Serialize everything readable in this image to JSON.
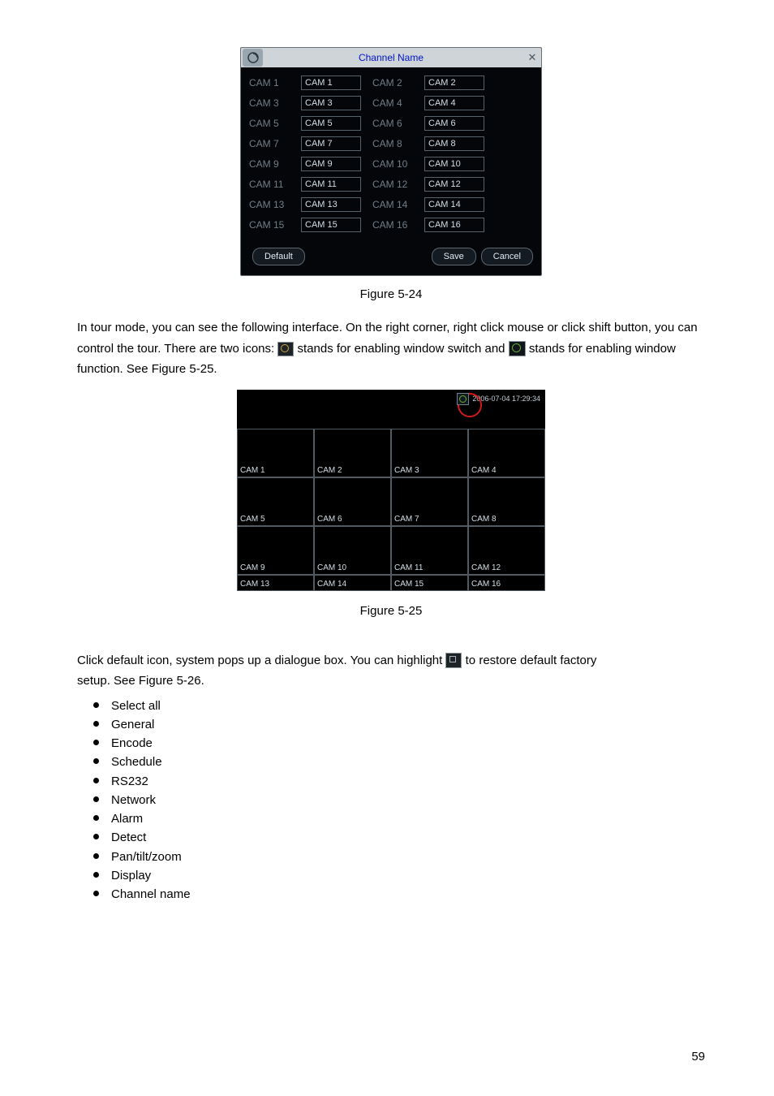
{
  "dialog": {
    "title": "Channel Name",
    "rows": [
      {
        "l1": "CAM 1",
        "v1": "CAM 1",
        "l2": "CAM 2",
        "v2": "CAM 2"
      },
      {
        "l1": "CAM 3",
        "v1": "CAM 3",
        "l2": "CAM 4",
        "v2": "CAM 4"
      },
      {
        "l1": "CAM 5",
        "v1": "CAM 5",
        "l2": "CAM 6",
        "v2": "CAM 6"
      },
      {
        "l1": "CAM 7",
        "v1": "CAM 7",
        "l2": "CAM 8",
        "v2": "CAM 8"
      },
      {
        "l1": "CAM 9",
        "v1": "CAM 9",
        "l2": "CAM 10",
        "v2": "CAM 10"
      },
      {
        "l1": "CAM 11",
        "v1": "CAM 11",
        "l2": "CAM 12",
        "v2": "CAM 12"
      },
      {
        "l1": "CAM 13",
        "v1": "CAM 13",
        "l2": "CAM 14",
        "v2": "CAM 14"
      },
      {
        "l1": "CAM 15",
        "v1": "CAM 15",
        "l2": "CAM 16",
        "v2": "CAM 16"
      }
    ],
    "buttons": {
      "default": "Default",
      "save": "Save",
      "cancel": "Cancel"
    }
  },
  "caption1": "Figure 5-24",
  "para1_a": "In tour mode, you can see the following interface. On the right corner, right click mouse or click ",
  "para1_b": "shift button, you can control the tour. There are two icons: ",
  "para1_c": " stands for enabling window switch ",
  "para1_d": "and ",
  "para1_e": " stands for enabling window function. See Figure 5-25.",
  "tour": {
    "clock": "2006-07-04 17:29:34",
    "grid": [
      [
        "CAM 1",
        "CAM 2",
        "CAM 3",
        "CAM 4"
      ],
      [
        "CAM 5",
        "CAM 6",
        "CAM 7",
        "CAM 8"
      ],
      [
        "CAM 9",
        "CAM 10",
        "CAM 11",
        "CAM 12"
      ],
      [
        "CAM 13",
        "CAM 14",
        "CAM 15",
        "CAM 16"
      ]
    ]
  },
  "caption2": "Figure 5-25",
  "para2_a": "Click default icon, system pops up a dialogue box. You can highlight  ",
  "para2_b": " to restore default factory ",
  "para2_c": "setup. See Figure 5-26.",
  "bullets": [
    "Select all",
    "General",
    "Encode",
    "Schedule",
    "RS232",
    "Network",
    "Alarm",
    "Detect",
    "Pan/tilt/zoom",
    "Display",
    "Channel name"
  ],
  "page": "59"
}
